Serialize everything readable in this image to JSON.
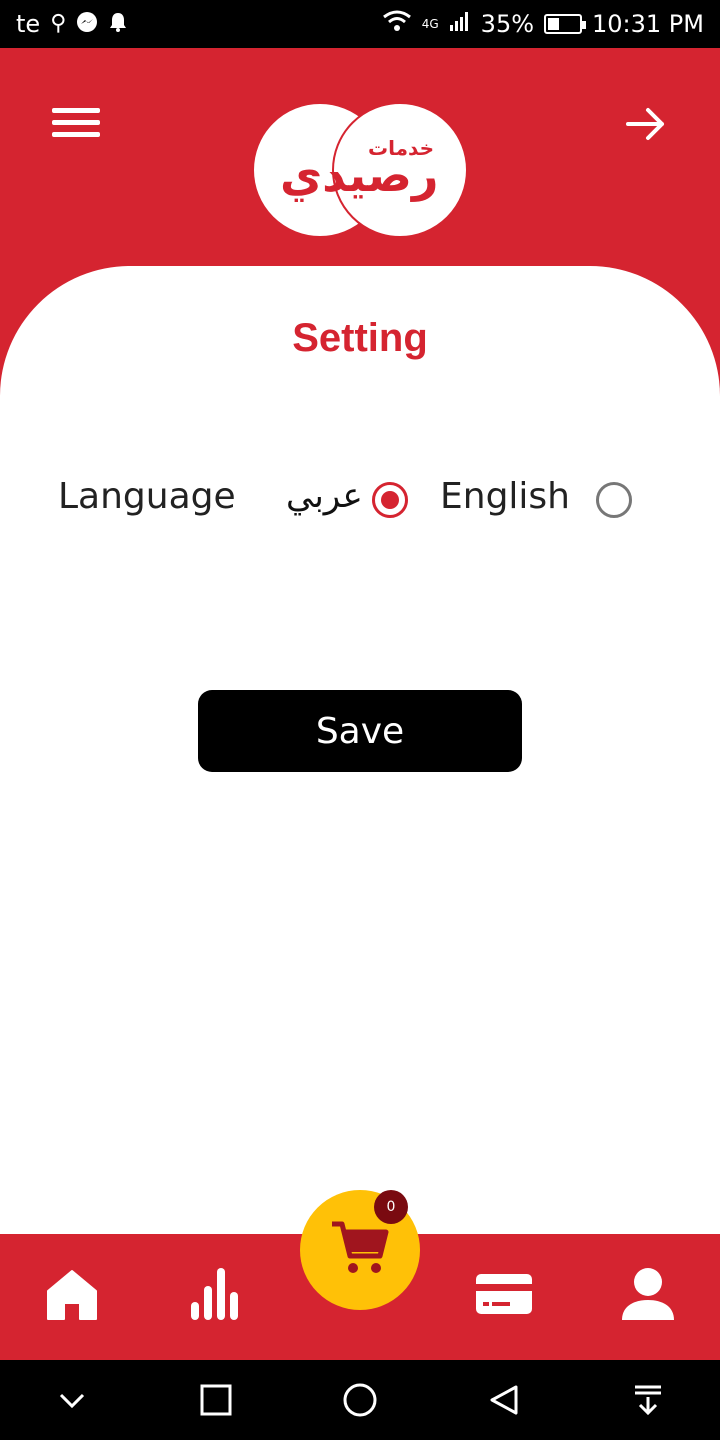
{
  "status_bar": {
    "carrier": "te",
    "network": "4G",
    "battery": "35%",
    "battery_level": 0.35,
    "time": "10:31 PM"
  },
  "header": {
    "logo_top_text": "خدمات",
    "logo_main_text": "رصيدي",
    "menu_icon": "hamburger-menu-icon",
    "back_icon": "arrow-right-icon"
  },
  "page": {
    "title": "Setting"
  },
  "language": {
    "label": "Language",
    "options": [
      {
        "label": "عربي",
        "selected": true
      },
      {
        "label": "English",
        "selected": false
      }
    ]
  },
  "save_button": {
    "label": "Save"
  },
  "bottom_nav": {
    "cart_count": "0",
    "icons": [
      "home-icon",
      "stats-icon",
      "cart-icon",
      "card-icon",
      "user-icon"
    ]
  },
  "colors": {
    "brand_red": "#d52430",
    "cart_yellow": "#ffc107",
    "badge_dark_red": "#7a0a10"
  }
}
